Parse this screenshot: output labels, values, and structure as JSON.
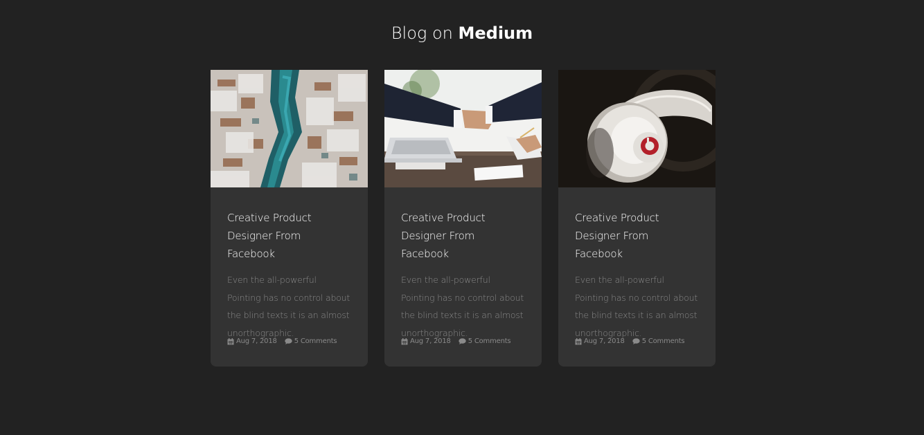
{
  "section": {
    "heading_prefix": "Blog on",
    "heading_brand": "Medium"
  },
  "posts": [
    {
      "image": "aerial-coast-rocks-photo",
      "title": "Creative Product Designer From Facebook",
      "excerpt": "Even the all-powerful Pointing has no control about the blind texts it is an almost unorthographic.",
      "date": "Aug 7, 2018",
      "comments": "5 Comments"
    },
    {
      "image": "business-handshake-photo",
      "title": "Creative Product Designer From Facebook",
      "excerpt": "Even the all-powerful Pointing has no control about the blind texts it is an almost unorthographic.",
      "date": "Aug 7, 2018",
      "comments": "5 Comments"
    },
    {
      "image": "headphones-photo",
      "title": "Creative Product Designer From Facebook",
      "excerpt": "Even the all-powerful Pointing has no control about the blind texts it is an almost unorthographic.",
      "date": "Aug 7, 2018",
      "comments": "5 Comments"
    }
  ],
  "icons": {
    "date": "calendar-icon",
    "comments": "comment-bubble-icon"
  },
  "colors": {
    "page_background": "#222222",
    "card_background": "#333333",
    "title_text": "#ffffff",
    "muted_text": "#8a8a8a"
  }
}
